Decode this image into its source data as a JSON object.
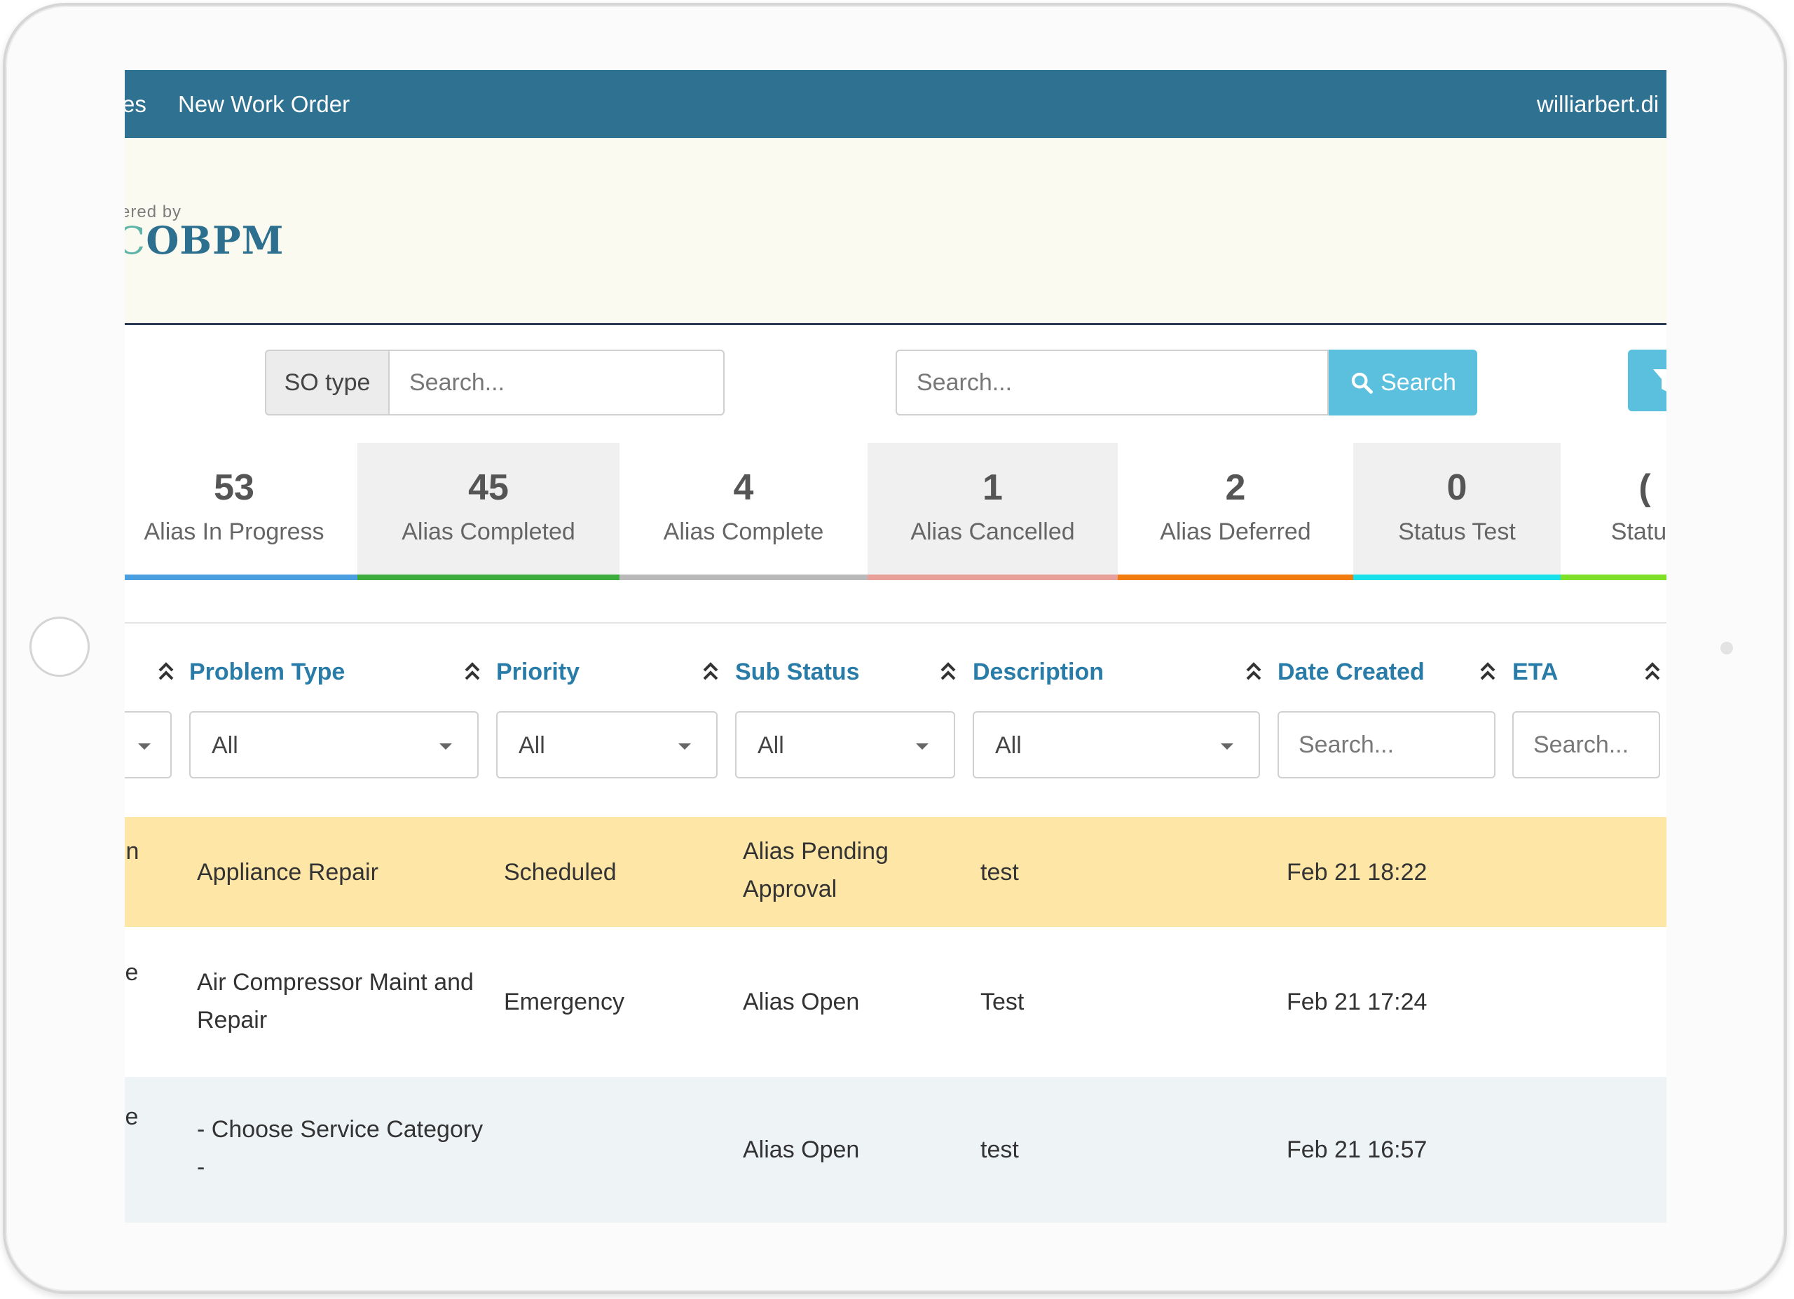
{
  "nav": {
    "prev_item": "es",
    "new_work_order": "New Work Order",
    "user": "williarbert.di"
  },
  "banner": {
    "powered_by": "ered by",
    "logo_prefix": "C",
    "logo_text": "OBPM"
  },
  "search": {
    "so_type_label": "SO type",
    "so_type_placeholder": "Search...",
    "main_placeholder": "Search...",
    "button_label": "Search"
  },
  "status_tiles": [
    {
      "count": "53",
      "label": "Alias In Progress",
      "color": "#4a9fe0"
    },
    {
      "count": "45",
      "label": "Alias Completed",
      "color": "#3bab3b"
    },
    {
      "count": "4",
      "label": "Alias Complete",
      "color": "#b9b9b9"
    },
    {
      "count": "1",
      "label": "Alias Cancelled",
      "color": "#e8a19a"
    },
    {
      "count": "2",
      "label": "Alias Deferred",
      "color": "#f27b0e"
    },
    {
      "count": "0",
      "label": "Status Test",
      "color": "#19e1ec"
    },
    {
      "count": "(",
      "label": "Status",
      "color": "#7ee127"
    }
  ],
  "table": {
    "columns": {
      "problem_type": "Problem Type",
      "priority": "Priority",
      "sub_status": "Sub Status",
      "description": "Description",
      "date_created": "Date Created",
      "eta": "ETA"
    },
    "filters": {
      "problem_type": "All",
      "priority": "All",
      "sub_status": "All",
      "description": "All",
      "date_created_placeholder": "Search...",
      "eta_placeholder": "Search..."
    },
    "rows": [
      {
        "prefix": "in",
        "problem_type": "Appliance Repair",
        "priority": "Scheduled",
        "sub_status": "Alias Pending Approval",
        "description": "test",
        "date_created": "Feb 21 18:22",
        "highlight_color": "#fde6a6"
      },
      {
        "prefix": "'e",
        "problem_type": "Air Compressor Maint and Repair",
        "priority": "Emergency",
        "sub_status": "Alias Open",
        "description": "Test",
        "date_created": "Feb 21 17:24",
        "highlight_color": "#ffffff"
      },
      {
        "prefix": "'e",
        "problem_type": "- Choose Service Category -",
        "priority": "",
        "sub_status": "Alias Open",
        "description": "test",
        "date_created": "Feb 21 16:57",
        "highlight_color": "#eef3f6"
      }
    ]
  }
}
